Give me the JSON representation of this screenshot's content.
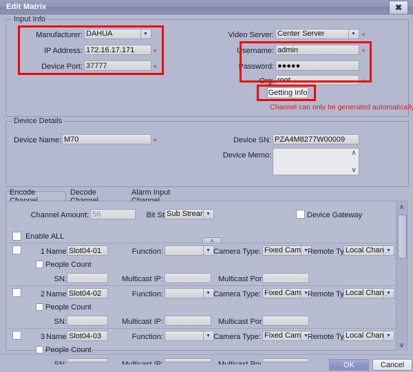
{
  "window": {
    "title": "Edit Matrix",
    "close_icon": "close-icon"
  },
  "input_info": {
    "legend": "Input Info",
    "manufacturer": {
      "label": "Manufacturer:",
      "value": "DAHUA"
    },
    "ip_address": {
      "label": "IP Address:",
      "value": "172.16.17.171",
      "required": "*"
    },
    "device_port": {
      "label": "Device Port:",
      "value": "37777",
      "required": "*"
    },
    "video_server": {
      "label": "Video Server:",
      "value": "Center Server",
      "required": "*"
    },
    "username": {
      "label": "Username:",
      "value": "admin",
      "required": "*"
    },
    "password": {
      "label": "Password:",
      "value": "●●●●●"
    },
    "org": {
      "label": "Org:",
      "value": "root",
      "required": "*"
    },
    "getting_info_button": "Getting Info",
    "warning": "Channel can only be generated automatically"
  },
  "device_details": {
    "legend": "Device Details",
    "device_name": {
      "label": "Device Name:",
      "value": "M70",
      "required": "*"
    },
    "device_sn": {
      "label": "Device SN:",
      "value": "PZA4M8277W00009"
    },
    "device_memo": {
      "label": "Device Memo:",
      "value": ""
    }
  },
  "tabs": [
    {
      "label": "Encode Channel",
      "active": true
    },
    {
      "label": "Decode Channel",
      "active": false
    },
    {
      "label": "Alarm Input Channel",
      "active": false
    }
  ],
  "encode_channel": {
    "channel_amount": {
      "label": "Channel Amount:",
      "value": "56"
    },
    "bit_stream": {
      "label": "Bit Stream:",
      "value": "Sub Stream"
    },
    "device_gateway": {
      "label": "Device Gateway",
      "checked": false
    },
    "enable_all": {
      "label": "Enable ALL",
      "checked": false
    },
    "col_labels": {
      "name": "Name:",
      "function": "Function:",
      "camera_type": "Camera Type:",
      "remote_type": "Remote Type:",
      "people_count": "People Count",
      "sn": "SN:",
      "multicast_ip": "Multicast IP:",
      "multicast_port": "Multicast Port:"
    },
    "rows": [
      {
        "index": "1",
        "name": "Slot04-01",
        "function": "",
        "camera_type": "Fixed Camera",
        "remote_type": "Local Channel",
        "people_count": false,
        "sn": "",
        "multicast_ip": "",
        "multicast_port": ""
      },
      {
        "index": "2",
        "name": "Slot04-02",
        "function": "",
        "camera_type": "Fixed Camera",
        "remote_type": "Local Channel",
        "people_count": false,
        "sn": "",
        "multicast_ip": "",
        "multicast_port": ""
      },
      {
        "index": "3",
        "name": "Slot04-03",
        "function": "",
        "camera_type": "Fixed Camera",
        "remote_type": "Local Channel",
        "people_count": false,
        "sn": "",
        "multicast_ip": "",
        "multicast_port": ""
      }
    ]
  },
  "footer": {
    "ok": "OK",
    "cancel": "Cancel"
  },
  "colors": {
    "annotation_red": "#f00500",
    "warning_red": "#d41b1b",
    "required_red": "#c8102e",
    "dialog_bg": "#b4b9cf",
    "titlebar": "#8f97b6",
    "ok_button": "#8e98c6"
  },
  "glyphs": {
    "dropdown_arrow": "▼",
    "chevron_up": "∧",
    "chevron_down": "∨",
    "close": "✖"
  }
}
